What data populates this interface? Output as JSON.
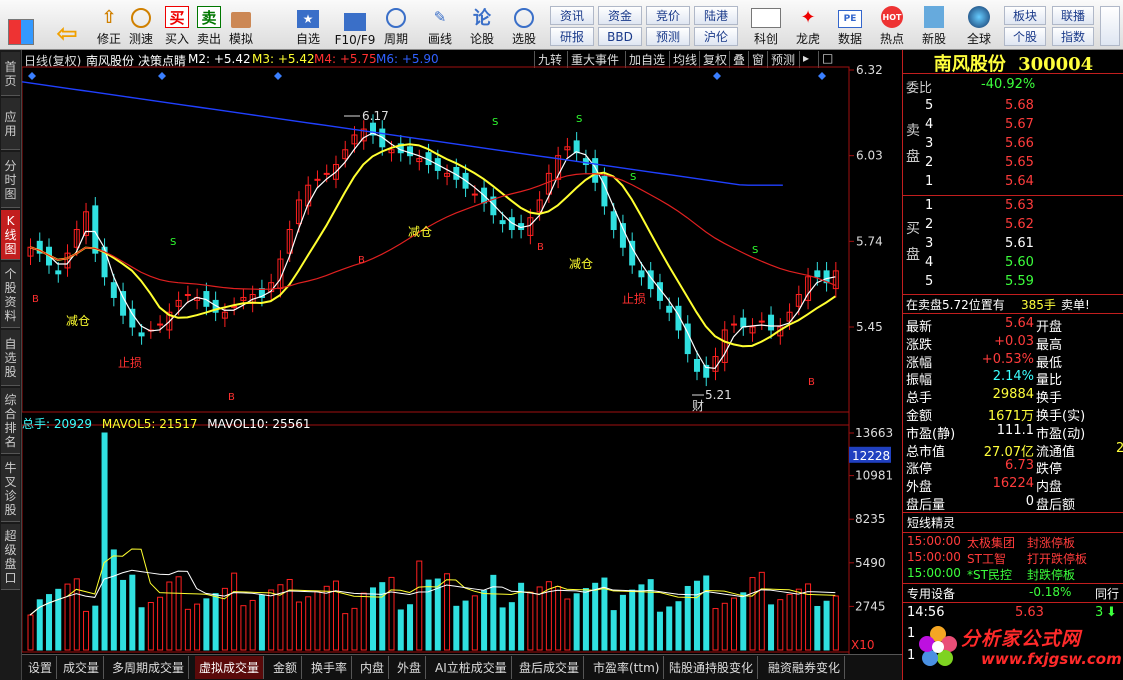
{
  "toolbar": {
    "buttons": [
      {
        "label": "",
        "icon": "grid-icon"
      },
      {
        "label": "",
        "icon": "back-arrow-icon"
      },
      {
        "label": "修正",
        "icon": "fix-icon"
      },
      {
        "label": "测速",
        "icon": "clock-icon"
      },
      {
        "label": "买入",
        "icon": "buy-icon"
      },
      {
        "label": "卖出",
        "icon": "sell-icon"
      },
      {
        "label": "模拟",
        "icon": "hammer-icon"
      },
      {
        "label": "自选",
        "icon": "star-icon"
      },
      {
        "label": "F10/F9",
        "icon": "f10-icon"
      },
      {
        "label": "周期",
        "icon": "cycle-icon"
      },
      {
        "label": "画线",
        "icon": "pen-icon"
      },
      {
        "label": "论股",
        "icon": "discuss-icon"
      },
      {
        "label": "选股",
        "icon": "select-icon"
      },
      {
        "label": "科创",
        "icon": "kechuang-icon"
      },
      {
        "label": "龙虎",
        "icon": "dragon-tiger-icon"
      },
      {
        "label": "数据",
        "icon": "pe-icon"
      },
      {
        "label": "热点",
        "icon": "hot-icon"
      },
      {
        "label": "新股",
        "icon": "new-stock-icon"
      },
      {
        "label": "全球",
        "icon": "globe-icon"
      }
    ],
    "small": [
      "资讯",
      "资金",
      "竞价",
      "陆港",
      "研报",
      "BBD",
      "预测",
      "沪伦",
      "板块",
      "联播",
      "个股",
      "指数"
    ],
    "buy_glyph": "买",
    "sell_glyph": "卖",
    "fix_glyph": "⇧",
    "back_glyph": "⇦"
  },
  "sidebar": [
    "首页",
    "应用",
    "分时图",
    "K线图",
    "个股资料",
    "自选股",
    "综合排名",
    "牛叉诊股",
    "超级盘口"
  ],
  "chart": {
    "header": {
      "period": "日线(复权)",
      "name": "南风股份",
      "indicator": "决策点睛",
      "m2": "M2: +5.42",
      "m3": "M3: +5.42",
      "m4": "M4: +5.75",
      "m6": "M6: +5.90"
    },
    "buttons": [
      "九转",
      "重大事件",
      "加自选",
      "均线",
      "复权",
      "叠",
      "窗",
      "预测"
    ],
    "price_axis": [
      "6.32",
      "6.03",
      "5.74",
      "5.45"
    ],
    "vol_axis": [
      "13663",
      "10981",
      "8235",
      "5490",
      "2745"
    ],
    "vol_highlight": "12228",
    "x10": "X10",
    "annotations": {
      "high": "6.17",
      "low": "5.21",
      "cai": "财",
      "reduce": "减仓",
      "stop": "止损",
      "sell_mark": "S",
      "buy_mark": "B"
    },
    "vol_header": {
      "total": "总手: 20929",
      "mavol5": "MAVOL5: 21517",
      "mavol10": "MAVOL10: 25561"
    },
    "colors": {
      "up": "#ff2020",
      "down": "#30e0e0",
      "ma_white": "#ffffff",
      "ma_yellow": "#ffff30",
      "ma_red": "#e02020",
      "ma_blue": "#2040ff"
    }
  },
  "bottom_tabs": [
    "设置",
    "成交量",
    "多周期成交量",
    "虚拟成交量",
    "金额",
    "换手率",
    "内盘",
    "外盘",
    "AI立桩成交量",
    "盘后成交量",
    "市盈率(ttm)",
    "陆股通持股变化",
    "融资融券变化"
  ],
  "panel": {
    "title": "南风股份",
    "code": "300004",
    "weibi_label": "委比",
    "weibi": "-40.92%",
    "sell_label": "卖盘",
    "buy_label": "买盘",
    "sell": [
      {
        "n": "5",
        "p": "5.68"
      },
      {
        "n": "4",
        "p": "5.67"
      },
      {
        "n": "3",
        "p": "5.66"
      },
      {
        "n": "2",
        "p": "5.65"
      },
      {
        "n": "1",
        "p": "5.64"
      }
    ],
    "buy": [
      {
        "n": "1",
        "p": "5.63"
      },
      {
        "n": "2",
        "p": "5.62"
      },
      {
        "n": "3",
        "p": "5.61"
      },
      {
        "n": "4",
        "p": "5.60"
      },
      {
        "n": "5",
        "p": "5.59"
      }
    ],
    "order_text": "在卖盘5.72位置有",
    "order_qty": "385手",
    "order_action": "卖单!",
    "stats": [
      {
        "l": "最新",
        "v": "5.64",
        "r": "开盘"
      },
      {
        "l": "涨跌",
        "v": "+0.03",
        "r": "最高"
      },
      {
        "l": "涨幅",
        "v": "+0.53%",
        "r": "最低"
      },
      {
        "l": "振幅",
        "v": "2.14%",
        "r": "量比"
      },
      {
        "l": "总手",
        "v": "29884",
        "r": "换手"
      },
      {
        "l": "金额",
        "v": "1671万",
        "r": "换手(实)"
      },
      {
        "l": "市盈(静)",
        "v": "111.1",
        "r": "市盈(动)"
      },
      {
        "l": "总市值",
        "v": "27.07亿",
        "r": "流通值"
      },
      {
        "l": "涨停",
        "v": "6.73",
        "r": "跌停"
      },
      {
        "l": "外盘",
        "v": "16224",
        "r": "内盘"
      },
      {
        "l": "盘后量",
        "v": "0",
        "r": "盘后额"
      }
    ],
    "cut_value": "2",
    "sprite_title": "短线精灵",
    "sprites": [
      {
        "t": "15:00:00",
        "s": "太极集团",
        "e": "封涨停板"
      },
      {
        "t": "15:00:00",
        "s": "ST工智",
        "e": "打开跌停板"
      },
      {
        "t": "15:00:00",
        "s": "*ST民控",
        "e": "封跌停板"
      }
    ],
    "industry": "专用设备",
    "industry_pct": "-0.18%",
    "industry_more": "同行",
    "tick_time": "14:56",
    "tick_price": "5.63",
    "tick_vol": "3",
    "tick_rows": [
      "1",
      "1"
    ],
    "logo_text": "分析家公式网",
    "logo_url": "www.fxjgsw.com"
  }
}
